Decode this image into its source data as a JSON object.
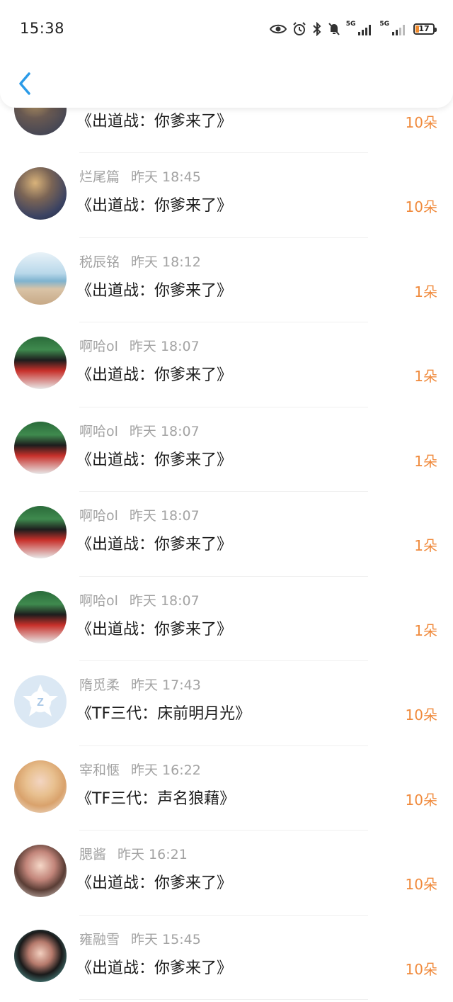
{
  "status_bar": {
    "time": "15:38",
    "net1": "5G",
    "net2": "5G",
    "battery": "17"
  },
  "colors": {
    "accent": "#2b9be8",
    "amount": "#f08a3c",
    "meta": "#a3a3a3",
    "title": "#1d1d1d"
  },
  "rows": [
    {
      "user": "",
      "time": "",
      "title": "《出道战：你爹来了》",
      "amount": "10朵",
      "avatar": "avatar-dark-guy"
    },
    {
      "user": "烂尾篇",
      "time": "昨天 18:45",
      "title": "《出道战：你爹来了》",
      "amount": "10朵",
      "avatar": "avatar-dark-guy"
    },
    {
      "user": "税辰铭",
      "time": "昨天 18:12",
      "title": "《出道战：你爹来了》",
      "amount": "1朵",
      "avatar": "avatar-beach"
    },
    {
      "user": "啊哈ol",
      "time": "昨天 18:07",
      "title": "《出道战：你爹来了》",
      "amount": "1朵",
      "avatar": "avatar-red-jacket"
    },
    {
      "user": "啊哈ol",
      "time": "昨天 18:07",
      "title": "《出道战：你爹来了》",
      "amount": "1朵",
      "avatar": "avatar-red-jacket"
    },
    {
      "user": "啊哈ol",
      "time": "昨天 18:07",
      "title": "《出道战：你爹来了》",
      "amount": "1朵",
      "avatar": "avatar-red-jacket"
    },
    {
      "user": "啊哈ol",
      "time": "昨天 18:07",
      "title": "《出道战：你爹来了》",
      "amount": "1朵",
      "avatar": "avatar-red-jacket"
    },
    {
      "user": "隋觅柔",
      "time": "昨天 17:43",
      "title": "《TF三代：床前明月光》",
      "amount": "10朵",
      "avatar": "avatar-default-logo"
    },
    {
      "user": "宰和惬",
      "time": "昨天 16:22",
      "title": "《TF三代：声名狼藉》",
      "amount": "10朵",
      "avatar": "avatar-blonde"
    },
    {
      "user": "腮酱",
      "time": "昨天 16:21",
      "title": "《出道战：你爹来了》",
      "amount": "10朵",
      "avatar": "avatar-girl-pink"
    },
    {
      "user": "雍融雪",
      "time": "昨天 15:45",
      "title": "《出道战：你爹来了》",
      "amount": "10朵",
      "avatar": "avatar-girl-dark-hair"
    }
  ]
}
